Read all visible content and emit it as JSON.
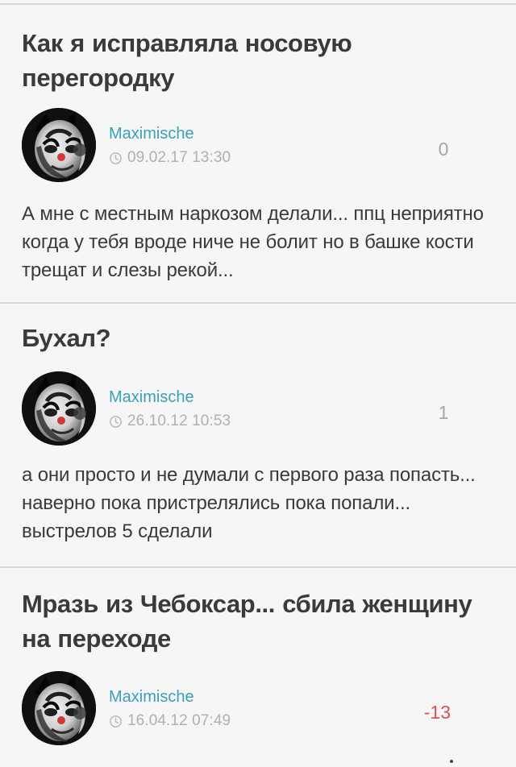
{
  "posts": [
    {
      "title": "Как я исправляла носовую перегородку",
      "author": "Maximische",
      "date": "09.02.17 13:30",
      "score": "0",
      "excerpt": "А мне с местным наркозом делали... ппц неприятно когда у тебя вроде ниче не болит но в башке кости трещат и слезы рекой..."
    },
    {
      "title": "Бухал?",
      "author": "Maximische",
      "date": "26.10.12 10:53",
      "score": "1",
      "excerpt": "а они просто и не думали с первого раза попасть... наверно пока пристрелялись пока попали... выстрелов 5 сделали"
    },
    {
      "title": "Мразь из Чебоксар... сбила женщину на переходе",
      "author": "Maximische",
      "date": "16.04.12 07:49",
      "score": "-13",
      "excerpt": ""
    }
  ],
  "colors": {
    "background": "#f6f6f6",
    "author": "#3c9fba",
    "date": "#b0b0b0",
    "neutral_score": "#a6a6a6",
    "negative_score": "#d95151",
    "text": "#3a3a3a"
  },
  "icons": {
    "avatar": "masked-clown-avatar",
    "timestamp": "clock-icon"
  }
}
